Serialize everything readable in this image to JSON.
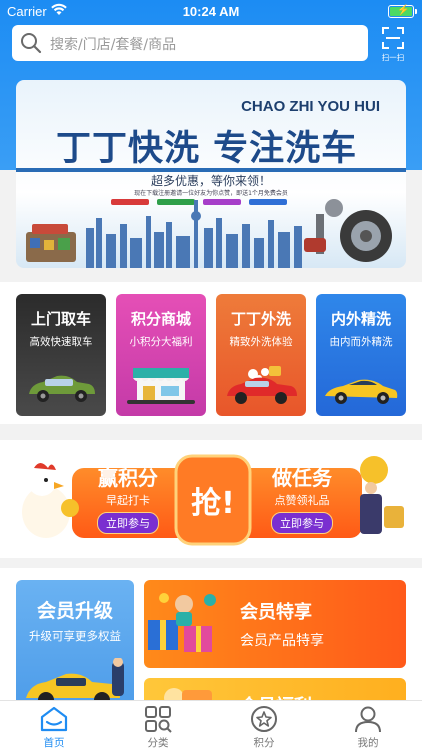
{
  "status_bar": {
    "carrier": "Carrier",
    "time": "10:24 AM"
  },
  "search": {
    "placeholder": "搜索/门店/套餐/商品"
  },
  "scan": {
    "label": "扫一扫"
  },
  "banner": {
    "english": "CHAO ZHI YOU HUI",
    "title": "丁丁快洗 专注洗车",
    "subtitle": "超多优惠，等你来领！",
    "fine_print": "现在下载注册邀请一位好友为你点赞，即送1个月免费会员",
    "chip_colors": [
      "#d83a3a",
      "#2f9f4a",
      "#a63ec9",
      "#2f6fd6"
    ]
  },
  "services": [
    {
      "title": "上门取车",
      "subtitle": "高效快速取车",
      "color": "#3a3a3a"
    },
    {
      "title": "积分商城",
      "subtitle": "小积分大福利",
      "color": "#d548b9"
    },
    {
      "title": "丁丁外洗",
      "subtitle": "精致外洗体验",
      "color": "#f06a2e"
    },
    {
      "title": "内外精洗",
      "subtitle": "由内而外精洗",
      "color": "#2d7be8"
    }
  ],
  "promo": {
    "left_title": "赢积分",
    "left_sub": "早起打卡",
    "left_btn": "立即参与",
    "center": "抢!",
    "right_title": "做任务",
    "right_sub": "点赞领礼品",
    "right_btn": "立即参与"
  },
  "member": {
    "upgrade_title": "会员升级",
    "upgrade_sub": "升级可享更多权益",
    "enjoy_title": "会员特享",
    "enjoy_sub": "会员产品特享",
    "activity_title": "会员福利"
  },
  "tabs": [
    {
      "label": "首页",
      "icon": "home-icon",
      "active": true
    },
    {
      "label": "分类",
      "icon": "grid-icon",
      "active": false
    },
    {
      "label": "积分",
      "icon": "star-icon",
      "active": false
    },
    {
      "label": "我的",
      "icon": "user-icon",
      "active": false
    }
  ],
  "colors": {
    "brand_blue": "#1f8cf2",
    "promo_orange": "#ff6a1a"
  }
}
